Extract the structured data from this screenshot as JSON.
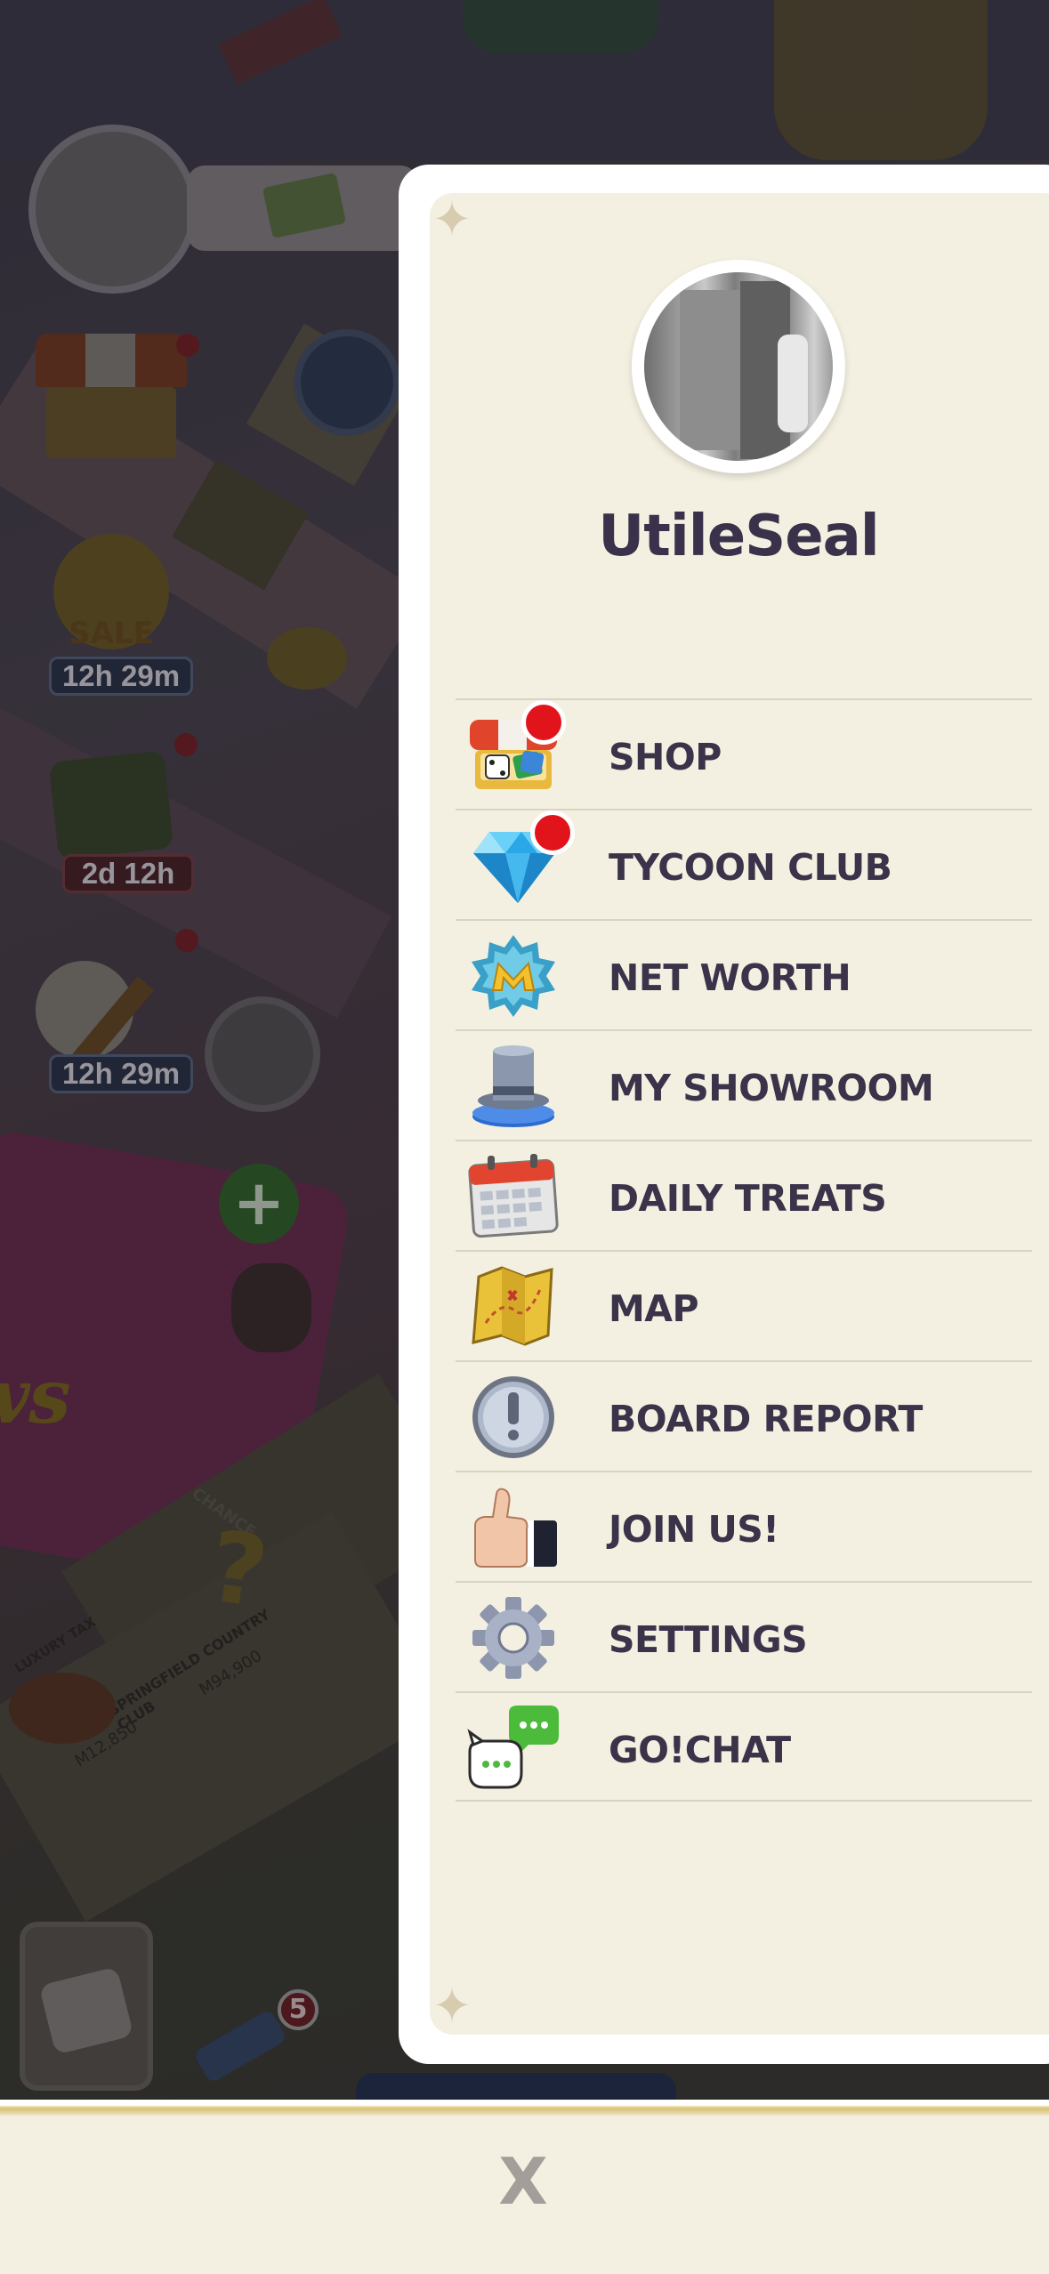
{
  "background": {
    "timers": [
      "12h 29m",
      "2d 12h",
      "12h 29m"
    ],
    "sale_label": "SALE",
    "dice_badge_count": "5",
    "board_text": {
      "property_1": "SPRINGFIELD COUNTRY CLUB",
      "price_1": "M94,900",
      "chance": "CHANCE",
      "tax": "LUXURY TAX",
      "price_2": "M12,850"
    }
  },
  "profile": {
    "username": "UtileSeal"
  },
  "menu": [
    {
      "label": "SHOP",
      "icon": "shop-icon",
      "badge": true
    },
    {
      "label": "TYCOON CLUB",
      "icon": "diamond-icon",
      "badge": true
    },
    {
      "label": "NET WORTH",
      "icon": "net-worth-icon",
      "badge": false
    },
    {
      "label": "MY SHOWROOM",
      "icon": "top-hat-icon",
      "badge": false
    },
    {
      "label": "DAILY TREATS",
      "icon": "calendar-icon",
      "badge": false
    },
    {
      "label": "MAP",
      "icon": "map-icon",
      "badge": false
    },
    {
      "label": "BOARD REPORT",
      "icon": "exclamation-icon",
      "badge": false
    },
    {
      "label": "JOIN US!",
      "icon": "thumbs-up-icon",
      "badge": false
    },
    {
      "label": "SETTINGS",
      "icon": "gear-icon",
      "badge": false
    },
    {
      "label": "GO!CHAT",
      "icon": "chat-bubbles-icon",
      "badge": false
    }
  ],
  "close_label": "X",
  "colors": {
    "panel_bg": "#f4f0e1",
    "label_text": "#3a3349",
    "badge": "#e2141b"
  }
}
